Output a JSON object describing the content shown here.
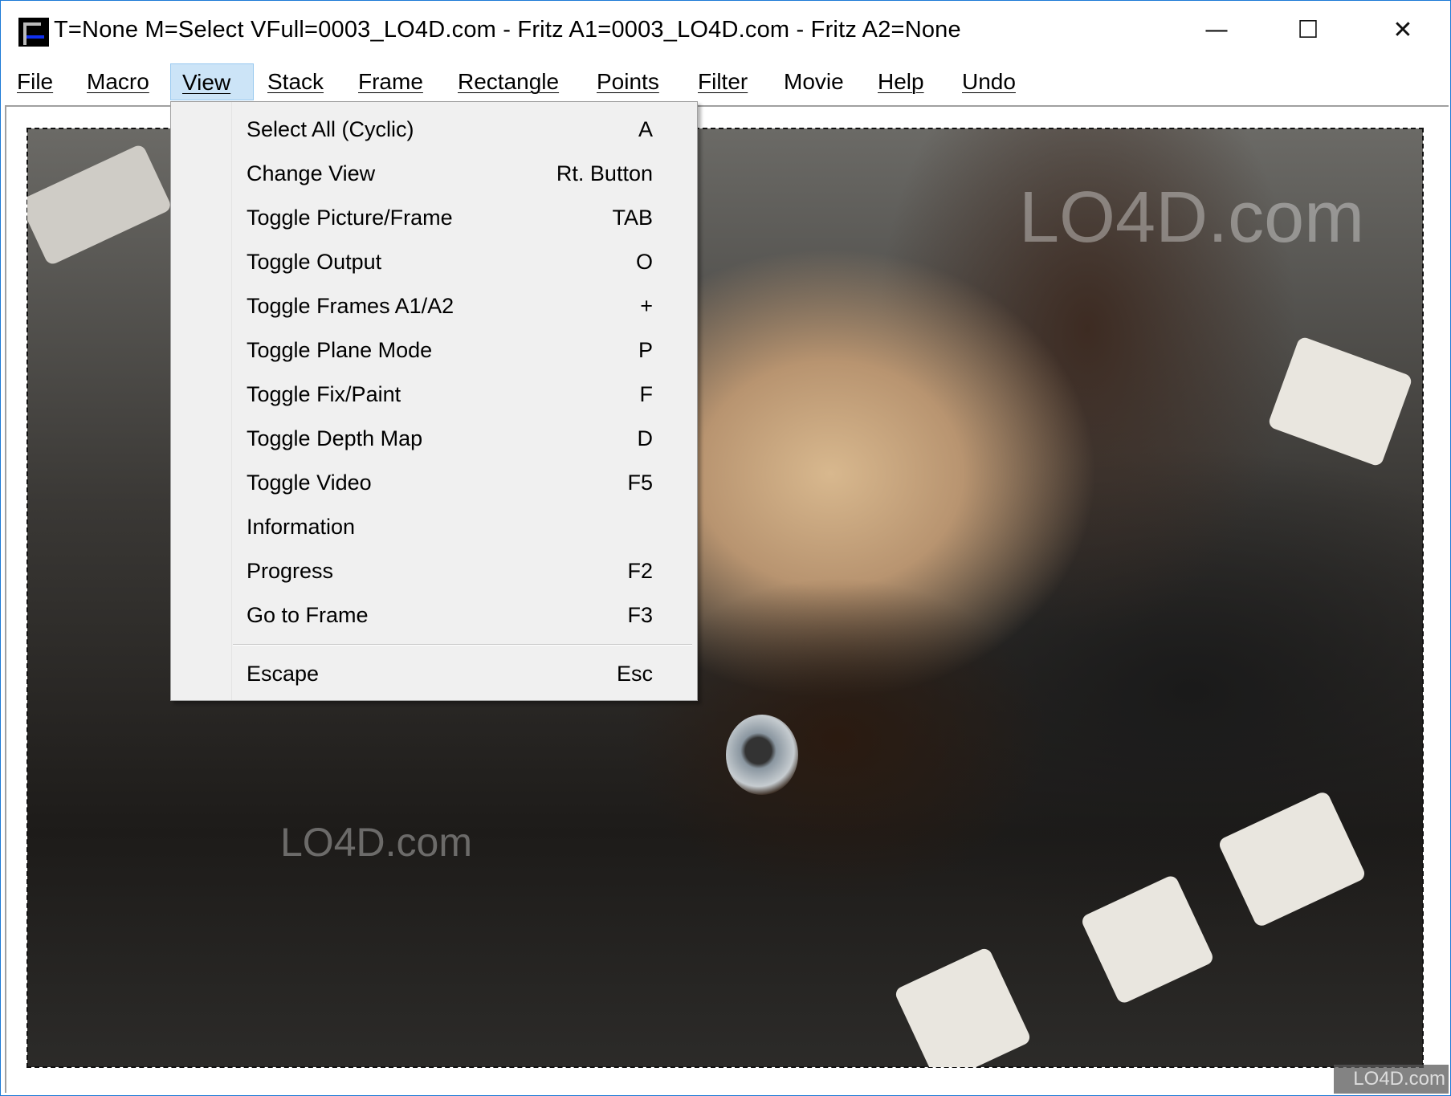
{
  "window": {
    "title": "T=None M=Select VFull=0003_LO4D.com - Fritz A1=0003_LO4D.com - Fritz A2=None",
    "controls": {
      "minimize": "—",
      "maximize": "☐",
      "close": "✕"
    }
  },
  "menubar": [
    {
      "label": "File"
    },
    {
      "label": "Macro"
    },
    {
      "label": "View",
      "active": true
    },
    {
      "label": "Stack"
    },
    {
      "label": "Frame"
    },
    {
      "label": "Rectangle"
    },
    {
      "label": "Points"
    },
    {
      "label": "Filter"
    },
    {
      "label": "Movie"
    },
    {
      "label": "Help"
    },
    {
      "label": "Undo"
    }
  ],
  "view_menu": {
    "items": [
      {
        "label": "Select All (Cyclic)",
        "shortcut": "A"
      },
      {
        "label": "Change View",
        "shortcut": "Rt. Button"
      },
      {
        "label": "Toggle Picture/Frame",
        "shortcut": "TAB"
      },
      {
        "label": "Toggle Output",
        "shortcut": "O"
      },
      {
        "label": "Toggle Frames A1/A2",
        "shortcut": "+"
      },
      {
        "label": "Toggle Plane Mode",
        "shortcut": "P"
      },
      {
        "label": "Toggle Fix/Paint",
        "shortcut": "F"
      },
      {
        "label": "Toggle Depth Map",
        "shortcut": "D"
      },
      {
        "label": "Toggle Video",
        "shortcut": "F5"
      },
      {
        "label": "Information",
        "shortcut": ""
      },
      {
        "label": "Progress",
        "shortcut": "F2"
      },
      {
        "label": "Go to Frame",
        "shortcut": "F3"
      }
    ],
    "escape": {
      "label": "Escape",
      "shortcut": "Esc"
    }
  },
  "watermarks": {
    "top": "LO4D.com",
    "bottom": "LO4D.com",
    "corner": "LO4D.com"
  }
}
